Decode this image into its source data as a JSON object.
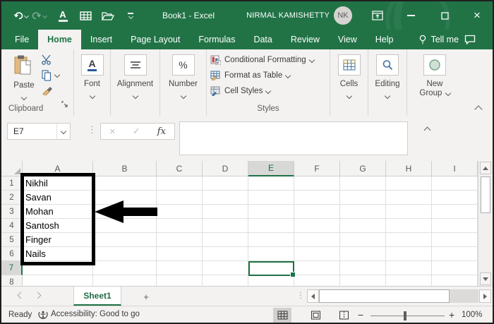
{
  "colors": {
    "excel_green": "#217346",
    "selection_green": "#1e7145",
    "ribbon_bg": "#f3f2f1"
  },
  "title_bar": {
    "title": "Book1  -  Excel",
    "user": "NIRMAL KAMISHETTY",
    "avatar_initials": "NK"
  },
  "tabs": [
    {
      "label": "File",
      "active": false
    },
    {
      "label": "Home",
      "active": true
    },
    {
      "label": "Insert",
      "active": false
    },
    {
      "label": "Page Layout",
      "active": false
    },
    {
      "label": "Formulas",
      "active": false
    },
    {
      "label": "Data",
      "active": false
    },
    {
      "label": "Review",
      "active": false
    },
    {
      "label": "View",
      "active": false
    },
    {
      "label": "Help",
      "active": false
    },
    {
      "label": "Tell me",
      "active": false
    }
  ],
  "ribbon": {
    "paste_label": "Paste",
    "clipboard_group": "Clipboard",
    "font_icon": "A",
    "font_group": "Font",
    "alignment_group": "Alignment",
    "number_icon": "%",
    "number_group": "Number",
    "styles_items": [
      "Conditional Formatting",
      "Format as Table",
      "Cell Styles"
    ],
    "styles_group": "Styles",
    "cells_group": "Cells",
    "editing_group": "Editing",
    "new_group_line1": "New",
    "new_group_line2": "Group"
  },
  "formula_bar": {
    "name_box": "E7",
    "cancel": "×",
    "enter": "✓",
    "fx": "fx",
    "value": ""
  },
  "grid": {
    "columns": [
      "A",
      "B",
      "C",
      "D",
      "E",
      "F",
      "G",
      "H",
      "I"
    ],
    "rows": [
      "1",
      "2",
      "3",
      "4",
      "5",
      "6",
      "7",
      "8"
    ],
    "values": [
      "Nikhil",
      "Savan",
      "Mohan",
      "Santosh",
      "Finger",
      "Nails"
    ],
    "selected_cell": "E7",
    "selected_column": "E",
    "selected_row": "7"
  },
  "sheet_bar": {
    "tab": "Sheet1"
  },
  "status_bar": {
    "ready": "Ready",
    "accessibility": "Accessibility: Good to go",
    "zoom": "100%"
  }
}
